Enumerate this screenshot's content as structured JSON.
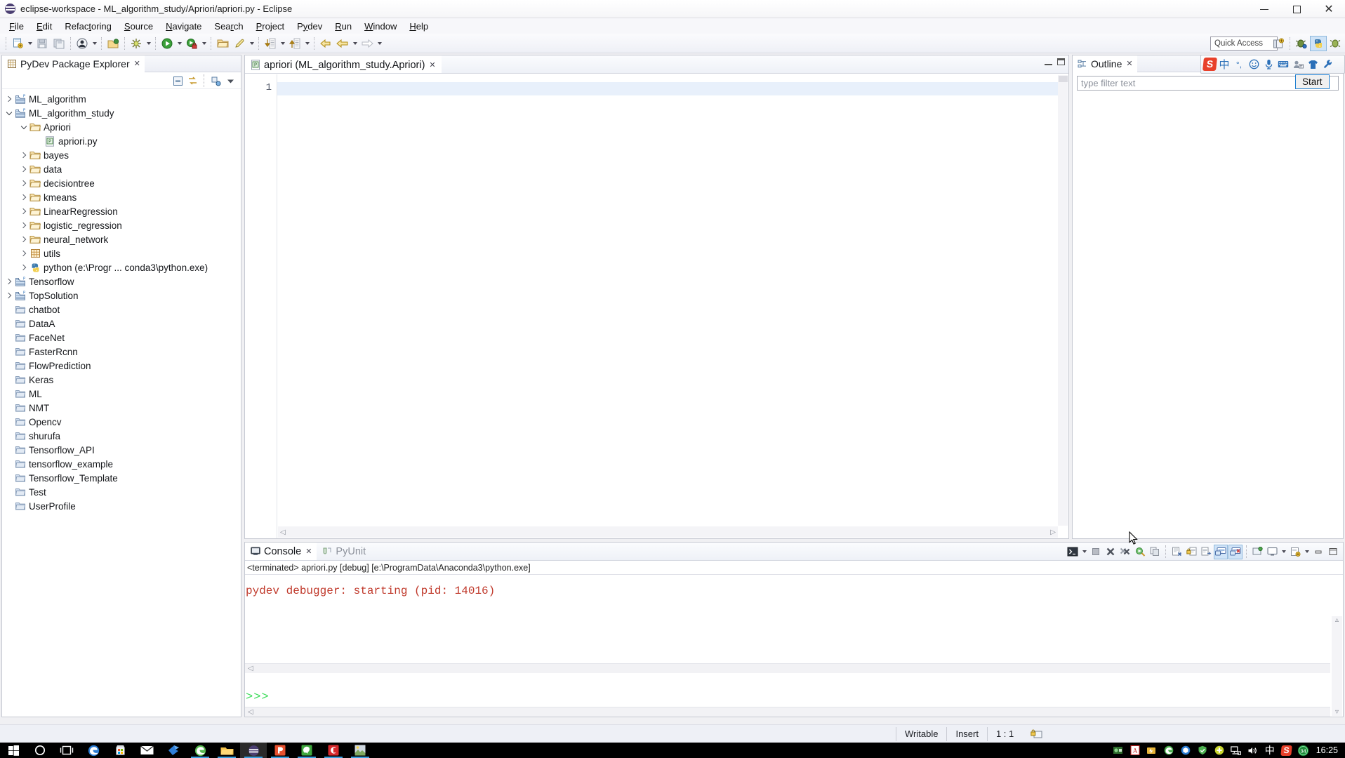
{
  "window": {
    "title": "eclipse-workspace - ML_algorithm_study/Apriori/apriori.py - Eclipse",
    "app_icon": "eclipse-icon",
    "minimize_label": "Minimize",
    "maximize_label": "Maximize",
    "close_label": "Close"
  },
  "menubar": {
    "items": [
      {
        "label": "File",
        "mnemonic": "F"
      },
      {
        "label": "Edit",
        "mnemonic": "E"
      },
      {
        "label": "Refactoring",
        "mnemonic": "t"
      },
      {
        "label": "Source",
        "mnemonic": "S"
      },
      {
        "label": "Navigate",
        "mnemonic": "N"
      },
      {
        "label": "Search",
        "mnemonic": "r"
      },
      {
        "label": "Project",
        "mnemonic": "P"
      },
      {
        "label": "Pydev",
        "mnemonic": "y"
      },
      {
        "label": "Run",
        "mnemonic": "R"
      },
      {
        "label": "Window",
        "mnemonic": "W"
      },
      {
        "label": "Help",
        "mnemonic": "H"
      }
    ]
  },
  "toolbar": {
    "quick_access_placeholder": "Quick Access",
    "buttons": [
      {
        "name": "new-wizard-button",
        "icon": "new-file-icon",
        "dropdown": true
      },
      {
        "name": "save-button",
        "icon": "save-icon",
        "dropdown": false
      },
      {
        "name": "save-all-button",
        "icon": "save-all-icon",
        "dropdown": false
      },
      {
        "name": "debug-person-button",
        "icon": "user-icon",
        "dropdown": true
      },
      {
        "name": "open-type-button",
        "icon": "open-type-icon",
        "dropdown": false
      },
      {
        "name": "external-tools-button",
        "icon": "external-tools-icon",
        "dropdown": true
      },
      {
        "name": "run-button",
        "icon": "run-icon",
        "dropdown": true
      },
      {
        "name": "debug-button",
        "icon": "debug-icon",
        "dropdown": true
      },
      {
        "name": "open-folder-button",
        "icon": "folder-open-icon",
        "dropdown": false
      },
      {
        "name": "pencil-button",
        "icon": "pencil-icon",
        "dropdown": true
      },
      {
        "name": "next-annotation-button",
        "icon": "down-arrow-icon",
        "dropdown": true
      },
      {
        "name": "previous-annotation-button",
        "icon": "up-arrow-icon",
        "dropdown": true
      },
      {
        "name": "last-edit-location-button",
        "icon": "back-yellow-arrow-icon",
        "dropdown": false
      },
      {
        "name": "back-button",
        "icon": "back-arrow-icon",
        "dropdown": true
      },
      {
        "name": "forward-button",
        "icon": "forward-arrow-icon",
        "dropdown": true
      }
    ],
    "perspective_buttons": [
      {
        "name": "open-perspective-button",
        "icon": "open-perspective-icon",
        "active": false
      },
      {
        "name": "perspective-debug-button",
        "icon": "debug-perspective-icon",
        "active": false
      },
      {
        "name": "perspective-pydev-button",
        "icon": "pydev-perspective-icon",
        "active": true
      },
      {
        "name": "perspective-pydev-debug-button",
        "icon": "pydev-debug-perspective-icon",
        "active": false
      }
    ]
  },
  "package_explorer": {
    "title": "PyDev Package Explorer",
    "close_label": "✕",
    "tools": [
      {
        "name": "collapse-all-button",
        "icon": "collapse-all-icon"
      },
      {
        "name": "link-with-editor-button",
        "icon": "link-editor-icon"
      },
      {
        "name": "focus-on-active-task-button",
        "icon": "focus-task-icon"
      },
      {
        "name": "view-menu-button",
        "icon": "view-menu-icon"
      }
    ],
    "tree": [
      {
        "label": "ML_algorithm",
        "icon": "pydev-project-icon",
        "indent": 0,
        "twist": "collapsed"
      },
      {
        "label": "ML_algorithm_study",
        "icon": "pydev-project-icon",
        "indent": 0,
        "twist": "expanded"
      },
      {
        "label": "Apriori",
        "icon": "folder-icon",
        "indent": 1,
        "twist": "expanded"
      },
      {
        "label": "apriori.py",
        "icon": "python-file-icon",
        "indent": 2,
        "twist": "none"
      },
      {
        "label": "bayes",
        "icon": "folder-icon",
        "indent": 1,
        "twist": "collapsed"
      },
      {
        "label": "data",
        "icon": "folder-icon",
        "indent": 1,
        "twist": "collapsed"
      },
      {
        "label": "decisiontree",
        "icon": "folder-icon",
        "indent": 1,
        "twist": "collapsed"
      },
      {
        "label": "kmeans",
        "icon": "folder-icon",
        "indent": 1,
        "twist": "collapsed"
      },
      {
        "label": "LinearRegression",
        "icon": "folder-icon",
        "indent": 1,
        "twist": "collapsed"
      },
      {
        "label": "logistic_regression",
        "icon": "folder-icon",
        "indent": 1,
        "twist": "collapsed"
      },
      {
        "label": "neural_network",
        "icon": "folder-icon",
        "indent": 1,
        "twist": "collapsed"
      },
      {
        "label": "utils",
        "icon": "package-icon",
        "indent": 1,
        "twist": "collapsed"
      },
      {
        "label": "python  (e:\\Progr ... conda3\\python.exe)",
        "icon": "python-interpreter-icon",
        "indent": 1,
        "twist": "collapsed"
      },
      {
        "label": "Tensorflow",
        "icon": "pydev-project-icon",
        "indent": 0,
        "twist": "collapsed"
      },
      {
        "label": "TopSolution",
        "icon": "pydev-project-icon",
        "indent": 0,
        "twist": "collapsed"
      },
      {
        "label": "chatbot",
        "icon": "closed-project-icon",
        "indent": 0,
        "twist": "none"
      },
      {
        "label": "DataA",
        "icon": "closed-project-icon",
        "indent": 0,
        "twist": "none"
      },
      {
        "label": "FaceNet",
        "icon": "closed-project-icon",
        "indent": 0,
        "twist": "none"
      },
      {
        "label": "FasterRcnn",
        "icon": "closed-project-icon",
        "indent": 0,
        "twist": "none"
      },
      {
        "label": "FlowPrediction",
        "icon": "closed-project-icon",
        "indent": 0,
        "twist": "none"
      },
      {
        "label": "Keras",
        "icon": "closed-project-icon",
        "indent": 0,
        "twist": "none"
      },
      {
        "label": "ML",
        "icon": "closed-project-icon",
        "indent": 0,
        "twist": "none"
      },
      {
        "label": "NMT",
        "icon": "closed-project-icon",
        "indent": 0,
        "twist": "none"
      },
      {
        "label": "Opencv",
        "icon": "closed-project-icon",
        "indent": 0,
        "twist": "none"
      },
      {
        "label": "shurufa",
        "icon": "closed-project-icon",
        "indent": 0,
        "twist": "none"
      },
      {
        "label": "Tensorflow_API",
        "icon": "closed-project-icon",
        "indent": 0,
        "twist": "none"
      },
      {
        "label": "tensorflow_example",
        "icon": "closed-project-icon",
        "indent": 0,
        "twist": "none"
      },
      {
        "label": "Tensorflow_Template",
        "icon": "closed-project-icon",
        "indent": 0,
        "twist": "none"
      },
      {
        "label": "Test",
        "icon": "closed-project-icon",
        "indent": 0,
        "twist": "none"
      },
      {
        "label": "UserProfile",
        "icon": "closed-project-icon",
        "indent": 0,
        "twist": "none"
      }
    ]
  },
  "editor": {
    "tab_label": "apriori (ML_algorithm_study.Apriori)",
    "tab_icon": "python-file-icon",
    "tab_close": "✕",
    "line_numbers": [
      "1"
    ],
    "content_lines": [
      ""
    ],
    "minimize_label": "Minimize",
    "maximize_label": "Maximize"
  },
  "outline": {
    "title": "Outline",
    "title_icon": "outline-icon",
    "close_label": "✕",
    "filter_placeholder": "type filter text",
    "filter_value": ""
  },
  "console": {
    "tabs": [
      {
        "label": "Console",
        "icon": "console-icon",
        "active": true,
        "close": "✕"
      },
      {
        "label": "PyUnit",
        "icon": "pyunit-icon",
        "active": false
      }
    ],
    "status_line": "<terminated> apriori.py [debug] [e:\\ProgramData\\Anaconda3\\python.exe]",
    "output_text": "pydev debugger: starting (pid: 14016)",
    "output_color": "#c0392b",
    "prompt_text": ">>>",
    "prompt_color": "#3ddc5a",
    "tools": [
      {
        "name": "console-display-selected-button",
        "icon": "terminal-icon",
        "active": false,
        "dropdown": true
      },
      {
        "name": "console-terminate-button",
        "icon": "stop-icon",
        "active": false
      },
      {
        "name": "console-remove-launch-button",
        "icon": "remove-icon",
        "active": false
      },
      {
        "name": "console-remove-all-button",
        "icon": "remove-all-icon",
        "active": false
      },
      {
        "name": "console-relaunch-button",
        "icon": "relaunch-icon",
        "active": false
      },
      {
        "name": "console-copy-button",
        "icon": "copy-icon",
        "active": false
      },
      {
        "name": "console-clear-button",
        "icon": "clear-console-icon",
        "active": false
      },
      {
        "name": "console-lock-scroll-button",
        "icon": "scroll-lock-icon",
        "active": false
      },
      {
        "name": "console-word-wrap-button",
        "icon": "word-wrap-icon",
        "active": false
      },
      {
        "name": "console-show-on-output-button",
        "icon": "show-output-icon",
        "active": true
      },
      {
        "name": "console-show-on-error-button",
        "icon": "show-error-icon",
        "active": true
      },
      {
        "name": "console-pin-button",
        "icon": "pin-icon",
        "active": false
      },
      {
        "name": "console-display-console-button",
        "icon": "display-console-icon",
        "active": false,
        "dropdown": true
      },
      {
        "name": "console-open-console-button",
        "icon": "open-console-icon",
        "active": false,
        "dropdown": true
      },
      {
        "name": "console-minimize-button",
        "icon": "minimize-icon",
        "active": false
      },
      {
        "name": "console-maximize-button",
        "icon": "maximize-icon",
        "active": false
      }
    ]
  },
  "statusbar": {
    "writable": "Writable",
    "insert_mode": "Insert",
    "position": "1 : 1",
    "lock_icon": "smart-insert-icon"
  },
  "ime": {
    "name": "sogou-input-method",
    "logo_text": "S",
    "mode_label": "中",
    "items": [
      {
        "name": "sogou-logo-icon",
        "glyph": "S"
      },
      {
        "name": "ime-chinese-mode-icon",
        "glyph": "中"
      },
      {
        "name": "ime-punctuation-icon",
        "glyph": "°,"
      },
      {
        "name": "ime-emoji-icon",
        "glyph": "☺"
      },
      {
        "name": "ime-voice-input-icon",
        "glyph": "🎤"
      },
      {
        "name": "ime-soft-keyboard-icon",
        "glyph": "⌨"
      },
      {
        "name": "ime-user-icon",
        "glyph": "👤"
      },
      {
        "name": "ime-skin-icon",
        "glyph": "👕"
      },
      {
        "name": "ime-settings-icon",
        "glyph": "🔧"
      }
    ]
  },
  "tooltip": {
    "start_label": "Start"
  },
  "taskbar": {
    "items": [
      {
        "name": "start-button",
        "icon": "windows-logo-icon",
        "running": false
      },
      {
        "name": "cortana-button",
        "icon": "cortana-circle-icon",
        "running": false
      },
      {
        "name": "task-view-button",
        "icon": "task-view-icon",
        "running": false
      },
      {
        "name": "edge-button",
        "icon": "edge-icon",
        "running": false
      },
      {
        "name": "store-button",
        "icon": "microsoft-store-icon",
        "running": false
      },
      {
        "name": "mail-button",
        "icon": "mail-icon",
        "running": false
      },
      {
        "name": "foxmail-button",
        "icon": "foxmail-icon",
        "running": false
      },
      {
        "name": "browser-button",
        "icon": "green-browser-icon",
        "running": true
      },
      {
        "name": "file-explorer-button",
        "icon": "file-explorer-icon",
        "running": true
      },
      {
        "name": "eclipse-button",
        "icon": "eclipse-icon",
        "running": true,
        "focused": true
      },
      {
        "name": "powerpoint-button",
        "icon": "powerpoint-icon",
        "running": true
      },
      {
        "name": "wechat-button",
        "icon": "green-app-icon",
        "running": true
      },
      {
        "name": "app-red-button",
        "icon": "red-app-icon",
        "running": true
      },
      {
        "name": "photos-button",
        "icon": "photos-icon",
        "running": true
      }
    ],
    "tray": [
      {
        "name": "tray-nvidia-icon",
        "glyph": "■"
      },
      {
        "name": "tray-acrobat-icon",
        "glyph": "A"
      },
      {
        "name": "tray-thunder-icon",
        "glyph": "⚡"
      },
      {
        "name": "tray-browser-icon",
        "glyph": "●"
      },
      {
        "name": "tray-box-icon",
        "glyph": "◆"
      },
      {
        "name": "tray-shield-icon",
        "glyph": "🛡"
      },
      {
        "name": "tray-plus-icon",
        "glyph": "✚"
      },
      {
        "name": "tray-network-icon",
        "glyph": "🖧"
      },
      {
        "name": "tray-volume-icon",
        "glyph": "🔊"
      },
      {
        "name": "tray-ime-chinese-icon",
        "glyph": "中"
      },
      {
        "name": "tray-sogou-icon",
        "glyph": "S"
      },
      {
        "name": "tray-security-icon",
        "glyph": "34"
      }
    ],
    "clock": "16:25"
  }
}
